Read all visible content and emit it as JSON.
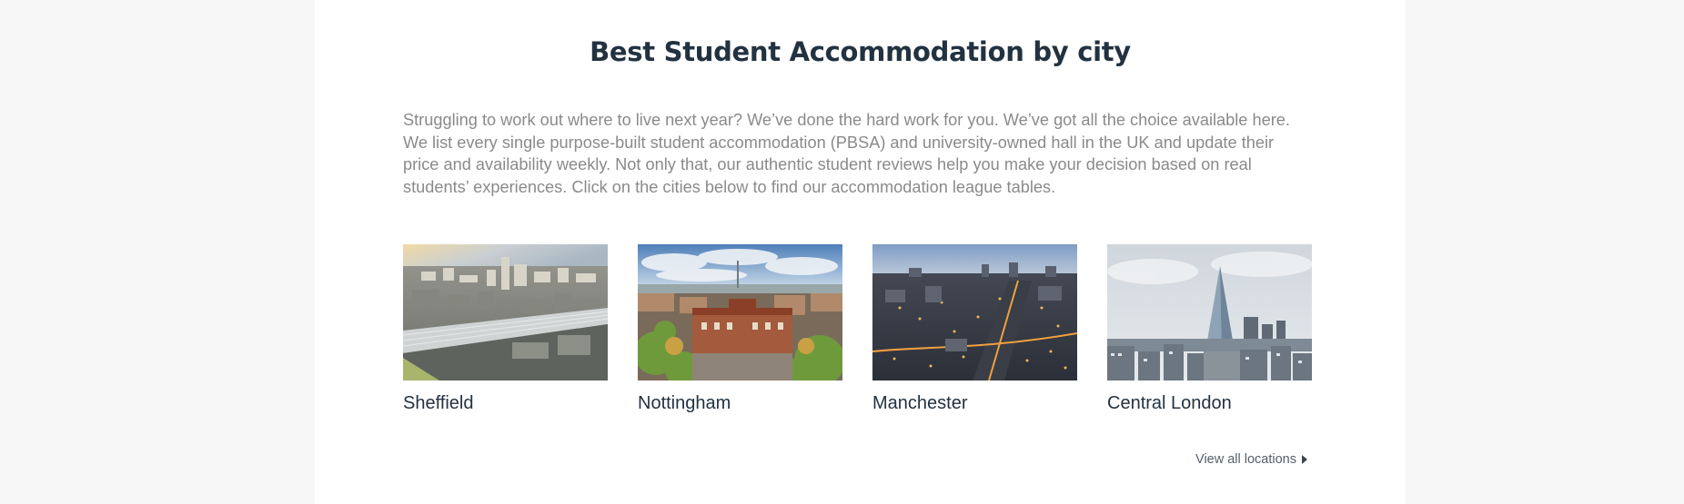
{
  "section": {
    "title": "Best Student Accommodation by city",
    "intro": "Struggling to work out where to live next year? We’ve done the hard work for you. We’ve got all the choice available here. We list every single purpose-built student accommodation (PBSA) and university-owned hall in the UK and update their price and availability weekly. Not only that, our authentic student reviews help you make your decision based on real students’ experiences. Click on the cities below to find our accommodation league tables."
  },
  "cities": [
    {
      "name": "Sheffield"
    },
    {
      "name": "Nottingham"
    },
    {
      "name": "Manchester"
    },
    {
      "name": "Central London"
    }
  ],
  "view_all": {
    "label": "View all locations",
    "icon": "caret-right-icon"
  },
  "colors": {
    "page_background": "#f7f7f7",
    "panel_background": "#ffffff",
    "heading": "#233240",
    "body_text": "#8a8a8a"
  }
}
